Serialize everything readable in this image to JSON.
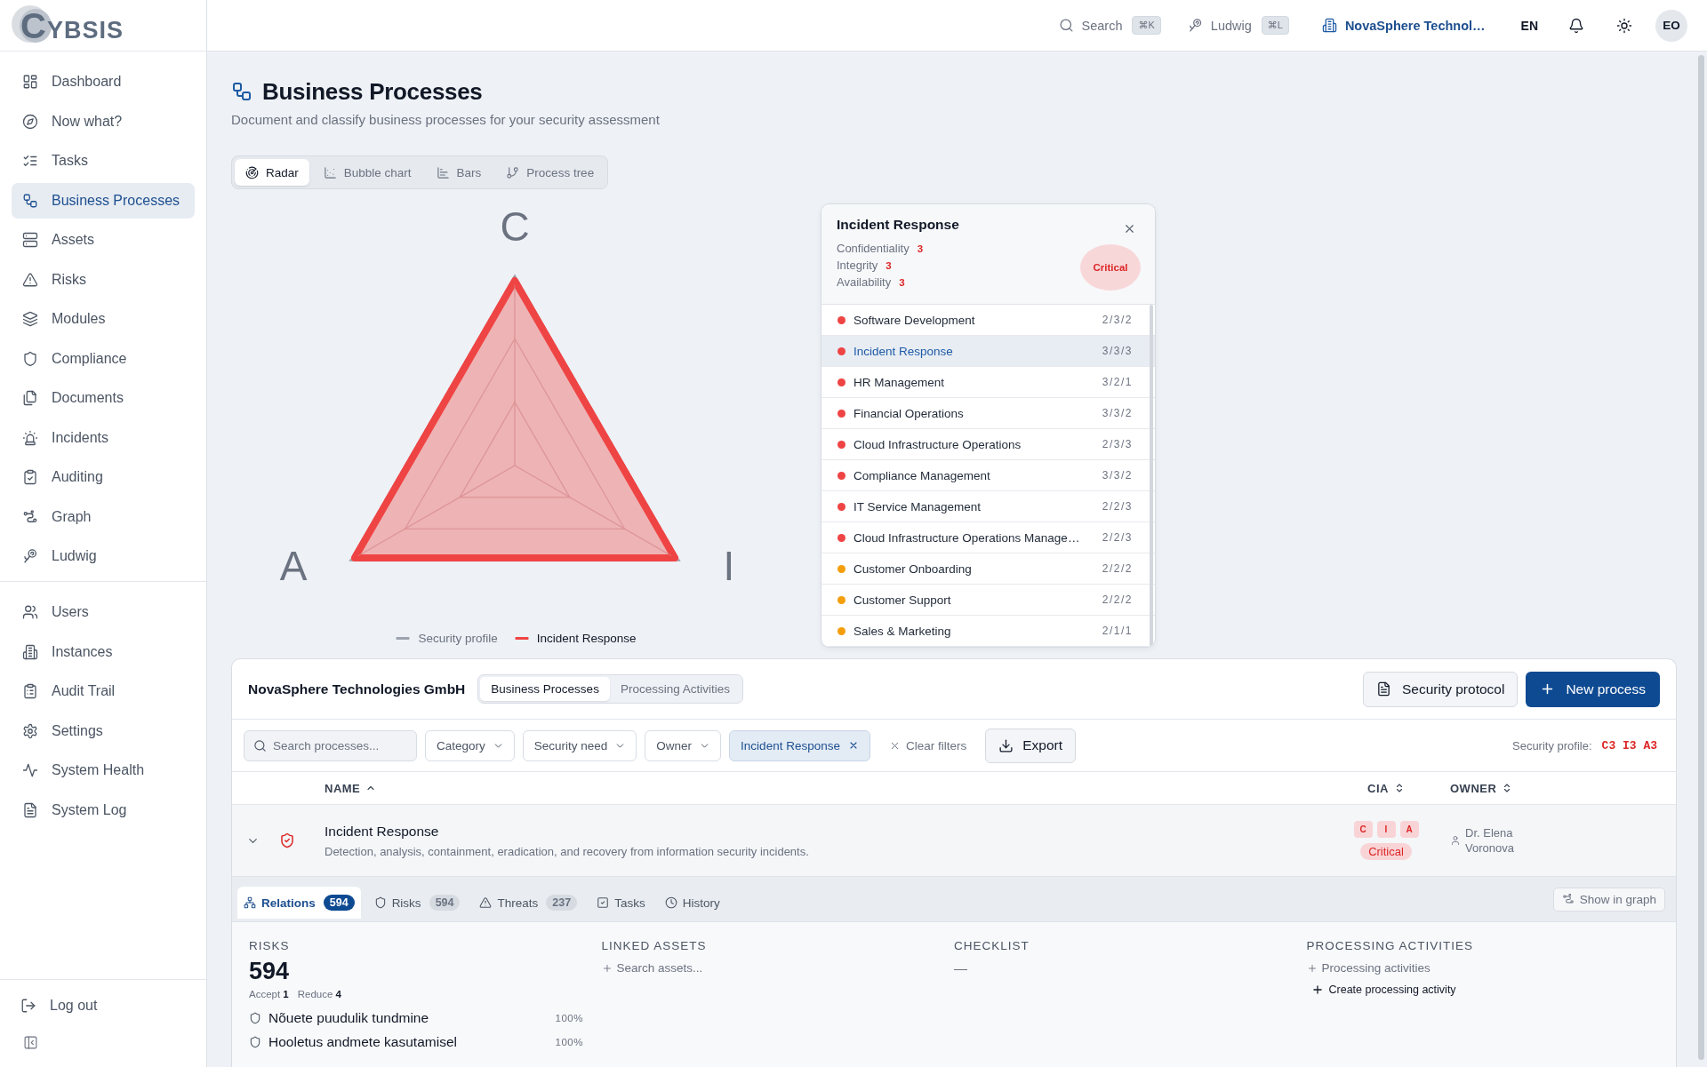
{
  "sidebar": {
    "logo": "CYBSIS",
    "main": [
      {
        "label": "Dashboard",
        "selected": false
      },
      {
        "label": "Now what?",
        "selected": false
      },
      {
        "label": "Tasks",
        "selected": false
      },
      {
        "label": "Business Processes",
        "selected": true
      },
      {
        "label": "Assets",
        "selected": false
      },
      {
        "label": "Risks",
        "selected": false
      },
      {
        "label": "Modules",
        "selected": false
      },
      {
        "label": "Compliance",
        "selected": false
      },
      {
        "label": "Documents",
        "selected": false
      },
      {
        "label": "Incidents",
        "selected": false
      },
      {
        "label": "Auditing",
        "selected": false
      },
      {
        "label": "Graph",
        "selected": false
      },
      {
        "label": "Ludwig",
        "selected": false
      }
    ],
    "admin": [
      {
        "label": "Users",
        "selected": false
      },
      {
        "label": "Instances",
        "selected": false
      },
      {
        "label": "Audit Trail",
        "selected": false
      },
      {
        "label": "Settings",
        "selected": false
      },
      {
        "label": "System Health",
        "selected": false
      },
      {
        "label": "System Log",
        "selected": false
      }
    ],
    "logout": "Log out"
  },
  "topbar": {
    "search": {
      "label": "Search",
      "shortcut": "⌘K"
    },
    "assistant": {
      "label": "Ludwig",
      "shortcut": "⌘L"
    },
    "organization": "NovaSphere Technol…",
    "language": "EN",
    "avatar": "EO"
  },
  "page": {
    "title": "Business Processes",
    "subtitle": "Document and classify business processes for your security assessment",
    "views": [
      {
        "label": "Radar",
        "selected": true
      },
      {
        "label": "Bubble chart",
        "selected": false
      },
      {
        "label": "Bars",
        "selected": false
      },
      {
        "label": "Process tree",
        "selected": false
      }
    ]
  },
  "radar": {
    "axes": [
      "C",
      "I",
      "A"
    ],
    "legend": [
      {
        "label": "Security profile",
        "color": "#9ca3af"
      },
      {
        "label": "Incident Response",
        "color": "#ef4444"
      }
    ]
  },
  "process_card": {
    "title": "Incident Response",
    "ratings": [
      {
        "label": "Confidentiality",
        "value": "3"
      },
      {
        "label": "Integrity",
        "value": "3"
      },
      {
        "label": "Availability",
        "value": "3"
      }
    ],
    "rating": "Critical",
    "processes": [
      {
        "name": "Software Development",
        "cia": "2/3/2",
        "color": "#ef4444",
        "selected": false
      },
      {
        "name": "Incident Response",
        "cia": "3/3/3",
        "color": "#ef4444",
        "selected": true
      },
      {
        "name": "HR Management",
        "cia": "3/2/1",
        "color": "#ef4444",
        "selected": false
      },
      {
        "name": "Financial Operations",
        "cia": "3/3/2",
        "color": "#ef4444",
        "selected": false
      },
      {
        "name": "Cloud Infrastructure Operations",
        "cia": "2/3/3",
        "color": "#ef4444",
        "selected": false
      },
      {
        "name": "Compliance Management",
        "cia": "3/3/2",
        "color": "#ef4444",
        "selected": false
      },
      {
        "name": "IT Service Management",
        "cia": "2/2/3",
        "color": "#ef4444",
        "selected": false
      },
      {
        "name": "Cloud Infrastructure Operations Manage…",
        "cia": "2/2/3",
        "color": "#ef4444",
        "selected": false
      },
      {
        "name": "Customer Onboarding",
        "cia": "2/2/2",
        "color": "#f59e0b",
        "selected": false
      },
      {
        "name": "Customer Support",
        "cia": "2/2/2",
        "color": "#f59e0b",
        "selected": false
      },
      {
        "name": "Sales & Marketing",
        "cia": "2/1/1",
        "color": "#f59e0b",
        "selected": false
      }
    ]
  },
  "panel": {
    "organization": "NovaSphere Technologies GmbH",
    "tabs": [
      {
        "label": "Business Processes",
        "selected": true
      },
      {
        "label": "Processing Activities",
        "selected": false
      }
    ],
    "actions": [
      {
        "label": "Security protocol",
        "kind": "secondary"
      },
      {
        "label": "New process",
        "kind": "primary"
      }
    ],
    "search": {
      "placeholder": "Search processes..."
    },
    "dropdowns": [
      "Category",
      "Security need",
      "Owner"
    ],
    "active_filters": [
      "Incident Response"
    ],
    "clear_filters": "Clear filters",
    "export": "Export",
    "profile": {
      "label": "Security profile:",
      "value": "C3 I3 A3"
    },
    "table": {
      "columns": [
        {
          "label": "NAME",
          "sorted": true
        },
        {
          "label": "CIA",
          "sorted": false
        },
        {
          "label": "OWNER",
          "sorted": false
        }
      ],
      "rows": [
        {
          "name": "Incident Response",
          "description": "Detection, analysis, containment, eradication, and recovery from information security incidents.",
          "expanded": true,
          "cia": [
            "C",
            "I",
            "A"
          ],
          "rating": "Critical",
          "owner": "Dr. Elena Voronova"
        }
      ]
    },
    "detail": {
      "tabs": [
        {
          "label": "Relations",
          "count": "594",
          "selected": true
        },
        {
          "label": "Risks",
          "count": "594",
          "selected": false
        },
        {
          "label": "Threats",
          "count": "237",
          "selected": false
        },
        {
          "label": "Tasks",
          "selected": false
        },
        {
          "label": "History",
          "selected": false
        }
      ],
      "graph_button": "Show in graph",
      "risks": {
        "heading": "RISKS",
        "total": "594",
        "breakdown": [
          "Accept **1**",
          "Reduce **4**"
        ],
        "items": [
          {
            "name": "Nõuete puudulik tundmine",
            "share": "100%"
          },
          {
            "name": "Hooletus andmete kasutamisel",
            "share": "100%"
          }
        ]
      },
      "assets": {
        "heading": "LINKED ASSETS",
        "action": "Search assets..."
      },
      "checklist": {
        "heading": "CHECKLIST",
        "value": "—"
      },
      "processing": {
        "heading": "PROCESSING ACTIVITIES",
        "action": "Processing activities",
        "create": "Create processing activity"
      }
    }
  }
}
